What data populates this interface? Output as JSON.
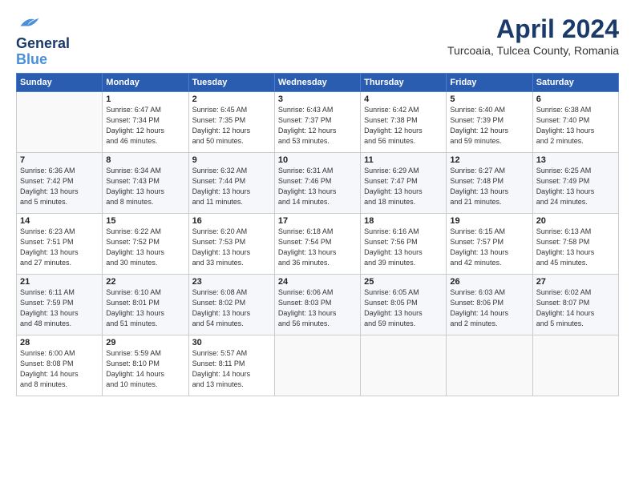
{
  "logo": {
    "line1": "General",
    "line2": "Blue"
  },
  "title": "April 2024",
  "subtitle": "Turcoaia, Tulcea County, Romania",
  "days_of_week": [
    "Sunday",
    "Monday",
    "Tuesday",
    "Wednesday",
    "Thursday",
    "Friday",
    "Saturday"
  ],
  "weeks": [
    [
      {
        "day": "",
        "info": ""
      },
      {
        "day": "1",
        "info": "Sunrise: 6:47 AM\nSunset: 7:34 PM\nDaylight: 12 hours\nand 46 minutes."
      },
      {
        "day": "2",
        "info": "Sunrise: 6:45 AM\nSunset: 7:35 PM\nDaylight: 12 hours\nand 50 minutes."
      },
      {
        "day": "3",
        "info": "Sunrise: 6:43 AM\nSunset: 7:37 PM\nDaylight: 12 hours\nand 53 minutes."
      },
      {
        "day": "4",
        "info": "Sunrise: 6:42 AM\nSunset: 7:38 PM\nDaylight: 12 hours\nand 56 minutes."
      },
      {
        "day": "5",
        "info": "Sunrise: 6:40 AM\nSunset: 7:39 PM\nDaylight: 12 hours\nand 59 minutes."
      },
      {
        "day": "6",
        "info": "Sunrise: 6:38 AM\nSunset: 7:40 PM\nDaylight: 13 hours\nand 2 minutes."
      }
    ],
    [
      {
        "day": "7",
        "info": "Sunrise: 6:36 AM\nSunset: 7:42 PM\nDaylight: 13 hours\nand 5 minutes."
      },
      {
        "day": "8",
        "info": "Sunrise: 6:34 AM\nSunset: 7:43 PM\nDaylight: 13 hours\nand 8 minutes."
      },
      {
        "day": "9",
        "info": "Sunrise: 6:32 AM\nSunset: 7:44 PM\nDaylight: 13 hours\nand 11 minutes."
      },
      {
        "day": "10",
        "info": "Sunrise: 6:31 AM\nSunset: 7:46 PM\nDaylight: 13 hours\nand 14 minutes."
      },
      {
        "day": "11",
        "info": "Sunrise: 6:29 AM\nSunset: 7:47 PM\nDaylight: 13 hours\nand 18 minutes."
      },
      {
        "day": "12",
        "info": "Sunrise: 6:27 AM\nSunset: 7:48 PM\nDaylight: 13 hours\nand 21 minutes."
      },
      {
        "day": "13",
        "info": "Sunrise: 6:25 AM\nSunset: 7:49 PM\nDaylight: 13 hours\nand 24 minutes."
      }
    ],
    [
      {
        "day": "14",
        "info": "Sunrise: 6:23 AM\nSunset: 7:51 PM\nDaylight: 13 hours\nand 27 minutes."
      },
      {
        "day": "15",
        "info": "Sunrise: 6:22 AM\nSunset: 7:52 PM\nDaylight: 13 hours\nand 30 minutes."
      },
      {
        "day": "16",
        "info": "Sunrise: 6:20 AM\nSunset: 7:53 PM\nDaylight: 13 hours\nand 33 minutes."
      },
      {
        "day": "17",
        "info": "Sunrise: 6:18 AM\nSunset: 7:54 PM\nDaylight: 13 hours\nand 36 minutes."
      },
      {
        "day": "18",
        "info": "Sunrise: 6:16 AM\nSunset: 7:56 PM\nDaylight: 13 hours\nand 39 minutes."
      },
      {
        "day": "19",
        "info": "Sunrise: 6:15 AM\nSunset: 7:57 PM\nDaylight: 13 hours\nand 42 minutes."
      },
      {
        "day": "20",
        "info": "Sunrise: 6:13 AM\nSunset: 7:58 PM\nDaylight: 13 hours\nand 45 minutes."
      }
    ],
    [
      {
        "day": "21",
        "info": "Sunrise: 6:11 AM\nSunset: 7:59 PM\nDaylight: 13 hours\nand 48 minutes."
      },
      {
        "day": "22",
        "info": "Sunrise: 6:10 AM\nSunset: 8:01 PM\nDaylight: 13 hours\nand 51 minutes."
      },
      {
        "day": "23",
        "info": "Sunrise: 6:08 AM\nSunset: 8:02 PM\nDaylight: 13 hours\nand 54 minutes."
      },
      {
        "day": "24",
        "info": "Sunrise: 6:06 AM\nSunset: 8:03 PM\nDaylight: 13 hours\nand 56 minutes."
      },
      {
        "day": "25",
        "info": "Sunrise: 6:05 AM\nSunset: 8:05 PM\nDaylight: 13 hours\nand 59 minutes."
      },
      {
        "day": "26",
        "info": "Sunrise: 6:03 AM\nSunset: 8:06 PM\nDaylight: 14 hours\nand 2 minutes."
      },
      {
        "day": "27",
        "info": "Sunrise: 6:02 AM\nSunset: 8:07 PM\nDaylight: 14 hours\nand 5 minutes."
      }
    ],
    [
      {
        "day": "28",
        "info": "Sunrise: 6:00 AM\nSunset: 8:08 PM\nDaylight: 14 hours\nand 8 minutes."
      },
      {
        "day": "29",
        "info": "Sunrise: 5:59 AM\nSunset: 8:10 PM\nDaylight: 14 hours\nand 10 minutes."
      },
      {
        "day": "30",
        "info": "Sunrise: 5:57 AM\nSunset: 8:11 PM\nDaylight: 14 hours\nand 13 minutes."
      },
      {
        "day": "",
        "info": ""
      },
      {
        "day": "",
        "info": ""
      },
      {
        "day": "",
        "info": ""
      },
      {
        "day": "",
        "info": ""
      }
    ]
  ]
}
